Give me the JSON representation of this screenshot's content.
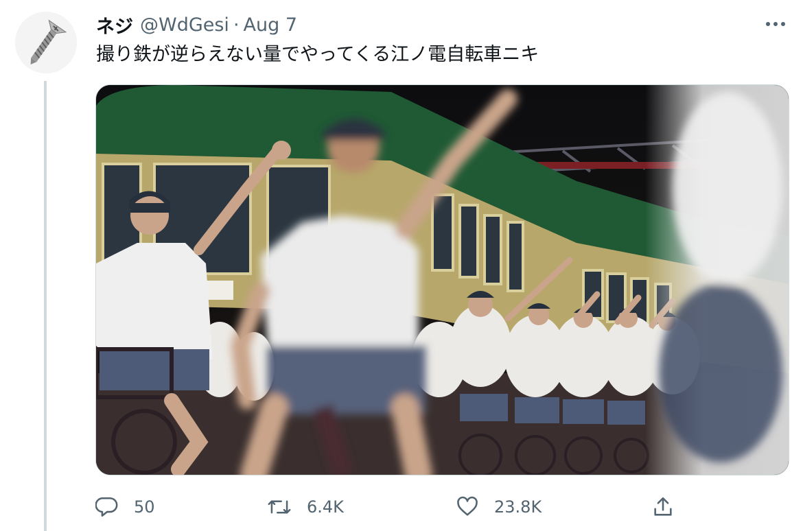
{
  "tweet": {
    "author_name": "ネジ",
    "handle": "@WdGesi",
    "separator": "·",
    "date": "Aug 7",
    "text": "撮り鉄が逆らえない量でやってくる江ノ電自転車ニキ",
    "more_icon": "more-horizontal-icon",
    "avatar_icon": "screw-icon"
  },
  "media": {
    "description_icon": "photo-image"
  },
  "actions": {
    "reply": {
      "icon": "reply-icon",
      "count": "50"
    },
    "retweet": {
      "icon": "retweet-icon",
      "count": "6.4K"
    },
    "like": {
      "icon": "heart-icon",
      "count": "23.8K"
    },
    "share": {
      "icon": "share-icon"
    }
  },
  "colors": {
    "text_primary": "#0f1419",
    "text_secondary": "#536471",
    "border": "#cfd9de"
  }
}
